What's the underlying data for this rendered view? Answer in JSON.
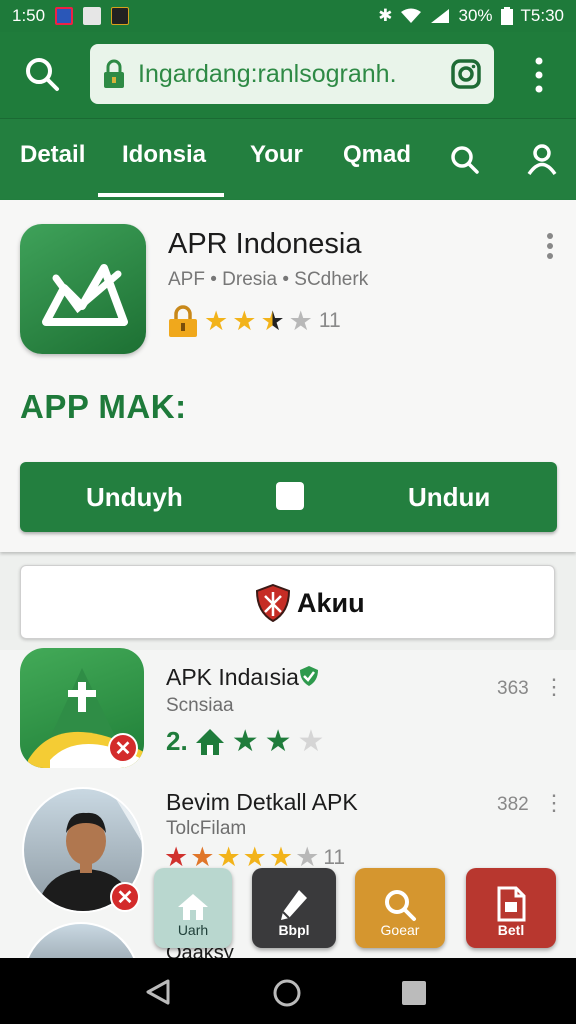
{
  "status": {
    "time_left": "1:50",
    "battery": "30%",
    "time_right": "T5:30"
  },
  "url_bar": {
    "text": "Ingardang:ranlsogranh."
  },
  "tabs": [
    "Detail",
    "Idonsia",
    "Your",
    "Qmad"
  ],
  "app": {
    "title": "APR Indonesia",
    "subtitle": "APF • Dresia • SCdherk",
    "rating": 3.5,
    "rating_count": "11"
  },
  "section_heading": "APP MAK:",
  "download_button": {
    "left_label": "Unduyh",
    "right_label": "Unduи"
  },
  "aksi_button": {
    "label": "Akиu"
  },
  "list": [
    {
      "title": "APK Indaısia",
      "subtitle": "Scnsiaa",
      "count": "363",
      "rating_prefix": "2."
    },
    {
      "title": "Bevim Detkall APK",
      "subtitle": "TolcFilam",
      "count": "382",
      "rating_count": "11"
    },
    {
      "title": "Qaaksy"
    }
  ],
  "fabs": [
    {
      "label": "Uarh",
      "color": "#b9d7cf"
    },
    {
      "label": "Bbpl",
      "color": "#3a3a3c"
    },
    {
      "label": "Goear",
      "color": "#d5962f"
    },
    {
      "label": "Betl",
      "color": "#b8372f"
    }
  ],
  "colors": {
    "primary": "#1f7c3b",
    "accent_gold": "#f2b31a",
    "danger": "#d32b2b"
  }
}
